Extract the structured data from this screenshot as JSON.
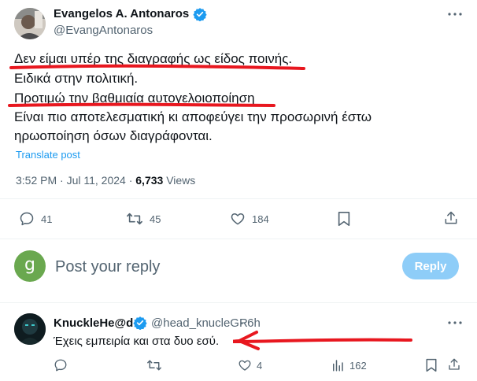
{
  "tweet": {
    "author_name": "Evangelos A. Antonaros",
    "author_handle": "@EvangAntonaros",
    "lines": [
      "Δεν είμαι υπέρ της διαγραφής ως είδος ποινής.",
      "Ειδικά στην πολιτική.",
      "Προτιμώ την βαθμιαία αυτογελοιοποίηση",
      "Είναι πιο αποτελεσματική κι αποφεύγει την προσωρινή έστω",
      "ηρωοποίηση όσων διαγράφονται."
    ],
    "translate": "Translate post",
    "time": "3:52 PM · Jul 11, 2024 · ",
    "views_count": "6,733",
    "views_label": " Views",
    "stats": {
      "replies": "41",
      "retweets": "45",
      "likes": "184"
    }
  },
  "composer": {
    "avatar_letter": "g",
    "placeholder": "Post your reply",
    "button": "Reply"
  },
  "reply": {
    "author_name": "KnuckleHe@d",
    "author_handle": "@head_knucleGR",
    "age": "· 6h",
    "text": "Έχεις εμπειρία και στα δυο εσύ.",
    "stats": {
      "likes": "4",
      "views": "162"
    }
  },
  "colors": {
    "verified": "#1d9bf0",
    "annotation_red": "#e8171f",
    "reply_button": "#8ecdf8",
    "composer_avatar": "#6aa84f"
  }
}
